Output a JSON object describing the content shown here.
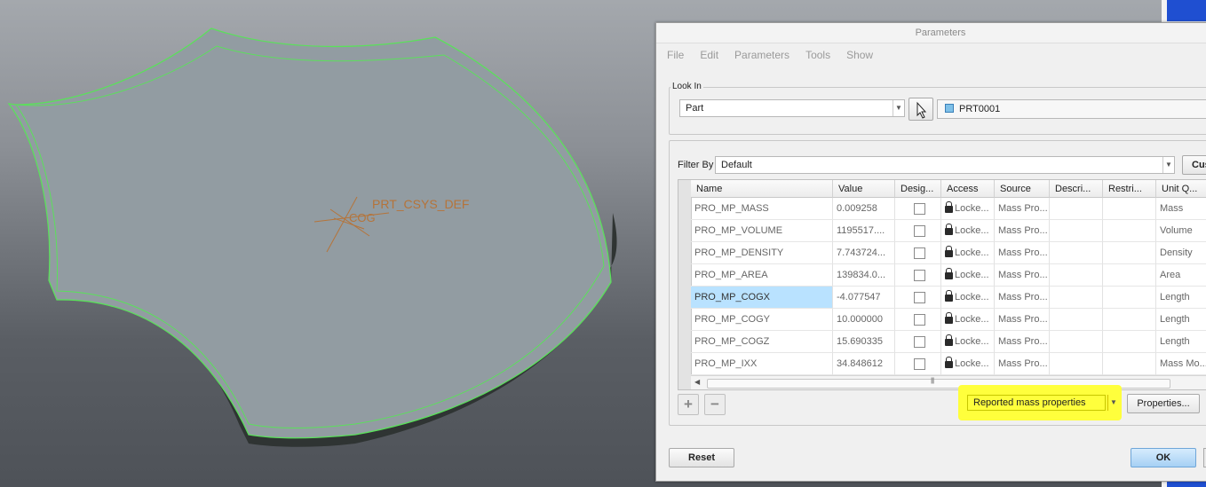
{
  "viewport": {
    "csys_label": "PRT_CSYS_DEF",
    "cog_label": "COG"
  },
  "dialog": {
    "title": "Parameters",
    "menu": [
      "File",
      "Edit",
      "Parameters",
      "Tools",
      "Show"
    ],
    "look_in": {
      "label": "Look In",
      "type_value": "Part",
      "model_name": "PRT0001"
    },
    "filter": {
      "label": "Filter By",
      "value": "Default",
      "custom_button": "Cus"
    },
    "table": {
      "columns": [
        "Name",
        "Value",
        "Desig...",
        "Access",
        "Source",
        "Descri...",
        "Restri...",
        "Unit Q..."
      ],
      "rows": [
        {
          "name": "PRO_MP_MASS",
          "value": "0.009258",
          "access": "Locke...",
          "source": "Mass Pro...",
          "unit": "Mass"
        },
        {
          "name": "PRO_MP_VOLUME",
          "value": "1195517....",
          "access": "Locke...",
          "source": "Mass Pro...",
          "unit": "Volume"
        },
        {
          "name": "PRO_MP_DENSITY",
          "value": "7.743724...",
          "access": "Locke...",
          "source": "Mass Pro...",
          "unit": "Density"
        },
        {
          "name": "PRO_MP_AREA",
          "value": "139834.0...",
          "access": "Locke...",
          "source": "Mass Pro...",
          "unit": "Area"
        },
        {
          "name": "PRO_MP_COGX",
          "value": "-4.077547",
          "access": "Locke...",
          "source": "Mass Pro...",
          "unit": "Length",
          "selected": true
        },
        {
          "name": "PRO_MP_COGY",
          "value": "10.000000",
          "access": "Locke...",
          "source": "Mass Pro...",
          "unit": "Length"
        },
        {
          "name": "PRO_MP_COGZ",
          "value": "15.690335",
          "access": "Locke...",
          "source": "Mass Pro...",
          "unit": "Length"
        },
        {
          "name": "PRO_MP_IXX",
          "value": "34.848612",
          "access": "Locke...",
          "source": "Mass Pro...",
          "unit": "Mass Mo..."
        }
      ]
    },
    "reported_properties": "Reported mass properties",
    "properties_button": "Properties...",
    "reset_button": "Reset",
    "ok_button": "OK",
    "highlight_color": "#ffff3c",
    "selection_color": "#b9e2ff"
  }
}
